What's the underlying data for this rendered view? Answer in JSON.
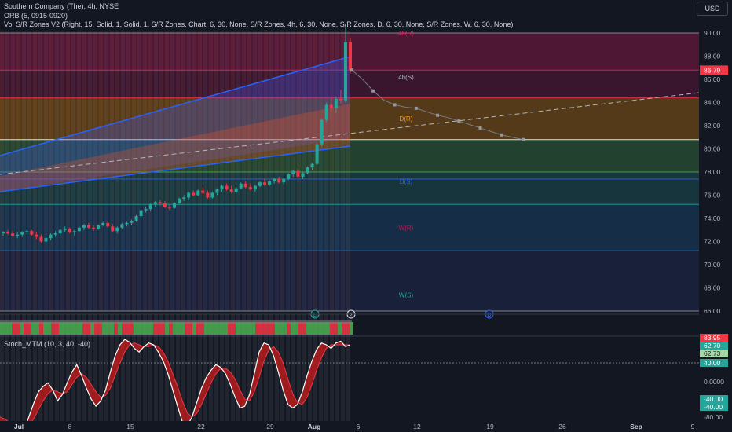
{
  "header": {
    "title": "Southern Company (The), 4h, NYSE",
    "orb": "ORB (5, 0915-0920)",
    "vol_sr": "Vol S/R Zones V2 (Right, 15, Solid, 1, Solid, 1, S/R Zones, Chart, 6, 30, None, S/R Zones, 4h, 6, 30, None, S/R Zones, D, 6, 30, None, S/R Zones, W, 6, 30, None)",
    "currency": "USD"
  },
  "chart_data": {
    "type": "candlestick",
    "price_axis": {
      "ticks": [
        "90.00",
        "88.00",
        "86.00",
        "84.00",
        "82.00",
        "80.00",
        "78.00",
        "76.00",
        "74.00",
        "72.00",
        "70.00",
        "68.00",
        "66.00"
      ],
      "ylim": [
        65.2,
        90.8
      ],
      "current_price": "86.79",
      "current_color": "#f23645"
    },
    "time_axis": {
      "labels": [
        "Jul",
        "8",
        "15",
        "22",
        "29",
        "Aug",
        "6",
        "12",
        "19",
        "26",
        "Sep",
        "9"
      ],
      "bold": [
        "Jul",
        "Aug",
        "Sep"
      ]
    },
    "zone_labels": [
      "4h(R)",
      "4h(S)",
      "D(R)",
      "D(S)",
      "W(R)",
      "W(S)"
    ],
    "event_markers": [
      "E",
      "⚡",
      "D"
    ],
    "candles": [
      [
        72.7,
        72.9,
        72.5,
        72.8
      ],
      [
        72.8,
        73.0,
        72.6,
        72.7
      ],
      [
        72.7,
        72.9,
        72.4,
        72.5
      ],
      [
        72.5,
        72.8,
        72.3,
        72.6
      ],
      [
        72.6,
        72.9,
        72.4,
        72.8
      ],
      [
        72.8,
        73.1,
        72.6,
        72.9
      ],
      [
        72.9,
        73.0,
        72.5,
        72.6
      ],
      [
        72.6,
        72.8,
        72.2,
        72.4
      ],
      [
        72.4,
        72.6,
        71.9,
        72.0
      ],
      [
        72.0,
        72.5,
        71.8,
        72.3
      ],
      [
        72.3,
        72.7,
        72.1,
        72.6
      ],
      [
        72.6,
        72.9,
        72.4,
        72.7
      ],
      [
        72.7,
        73.1,
        72.5,
        73.0
      ],
      [
        73.0,
        73.3,
        72.8,
        73.1
      ],
      [
        73.1,
        73.2,
        72.7,
        72.8
      ],
      [
        72.8,
        73.0,
        72.5,
        72.9
      ],
      [
        72.9,
        73.3,
        72.8,
        73.2
      ],
      [
        73.2,
        73.5,
        73.0,
        73.4
      ],
      [
        73.4,
        73.6,
        73.1,
        73.2
      ],
      [
        73.2,
        73.4,
        72.9,
        73.1
      ],
      [
        73.1,
        73.5,
        73.0,
        73.4
      ],
      [
        73.4,
        73.7,
        73.3,
        73.6
      ],
      [
        73.6,
        73.8,
        73.2,
        73.3
      ],
      [
        73.3,
        73.5,
        72.8,
        72.9
      ],
      [
        72.9,
        73.3,
        72.7,
        73.2
      ],
      [
        73.2,
        73.6,
        73.1,
        73.5
      ],
      [
        73.5,
        73.7,
        73.3,
        73.6
      ],
      [
        73.6,
        73.9,
        73.4,
        73.8
      ],
      [
        73.8,
        74.3,
        73.7,
        74.2
      ],
      [
        74.2,
        74.8,
        74.1,
        74.7
      ],
      [
        74.7,
        75.0,
        74.5,
        74.8
      ],
      [
        74.8,
        75.3,
        74.6,
        75.2
      ],
      [
        75.2,
        75.5,
        75.0,
        75.4
      ],
      [
        75.4,
        75.6,
        75.1,
        75.3
      ],
      [
        75.3,
        75.5,
        74.9,
        75.0
      ],
      [
        75.0,
        75.2,
        74.7,
        74.9
      ],
      [
        74.9,
        75.4,
        74.8,
        75.3
      ],
      [
        75.3,
        75.8,
        75.2,
        75.7
      ],
      [
        75.7,
        76.0,
        75.5,
        75.8
      ],
      [
        75.8,
        76.3,
        75.6,
        76.2
      ],
      [
        76.2,
        76.4,
        75.9,
        76.0
      ],
      [
        76.0,
        76.5,
        75.9,
        76.4
      ],
      [
        76.4,
        76.7,
        76.1,
        76.2
      ],
      [
        76.2,
        76.4,
        75.7,
        75.8
      ],
      [
        75.8,
        76.3,
        75.7,
        76.2
      ],
      [
        76.2,
        76.6,
        76.0,
        76.5
      ],
      [
        76.5,
        76.9,
        76.3,
        76.8
      ],
      [
        76.8,
        77.0,
        76.4,
        76.5
      ],
      [
        76.5,
        76.8,
        76.2,
        76.3
      ],
      [
        76.3,
        76.7,
        76.1,
        76.6
      ],
      [
        76.6,
        77.1,
        76.5,
        77.0
      ],
      [
        77.0,
        77.2,
        76.6,
        76.7
      ],
      [
        76.7,
        77.0,
        76.4,
        76.5
      ],
      [
        76.5,
        76.9,
        76.3,
        76.8
      ],
      [
        76.8,
        77.2,
        76.7,
        77.1
      ],
      [
        77.1,
        77.4,
        76.8,
        76.9
      ],
      [
        76.9,
        77.3,
        76.8,
        77.2
      ],
      [
        77.2,
        77.5,
        77.0,
        77.4
      ],
      [
        77.4,
        77.6,
        77.0,
        77.1
      ],
      [
        77.1,
        77.5,
        76.9,
        77.4
      ],
      [
        77.4,
        77.9,
        77.3,
        77.8
      ],
      [
        77.8,
        78.2,
        77.6,
        78.1
      ],
      [
        78.1,
        78.3,
        77.5,
        77.6
      ],
      [
        77.6,
        78.0,
        77.4,
        77.9
      ],
      [
        77.9,
        78.5,
        77.8,
        78.4
      ],
      [
        78.4,
        78.8,
        78.2,
        78.7
      ],
      [
        78.7,
        80.5,
        78.6,
        80.4
      ],
      [
        80.4,
        82.6,
        80.2,
        82.5
      ],
      [
        82.5,
        84.0,
        82.3,
        83.8
      ],
      [
        83.8,
        84.4,
        83.2,
        83.5
      ],
      [
        83.5,
        84.5,
        83.1,
        84.3
      ],
      [
        84.3,
        85.1,
        83.9,
        84.2
      ],
      [
        84.2,
        90.5,
        84.0,
        89.2
      ],
      [
        89.2,
        89.6,
        86.5,
        86.8
      ]
    ],
    "projection": [
      86.8,
      86.0,
      85.0,
      84.2,
      83.8,
      83.6,
      83.5,
      83.2,
      82.9,
      82.7,
      82.4,
      82.1,
      81.8,
      81.5,
      81.2,
      81.0,
      80.8
    ],
    "stoch_mtm": {
      "title": "Stoch_MTM (10, 3, 40, -40)",
      "ticks": [
        "0.0000",
        "-40.00",
        "-80.00"
      ],
      "ylim": [
        -82,
        88
      ],
      "badges": [
        "83.95",
        "62.70",
        "62.73",
        "40.00",
        "-40.00",
        "-40.00"
      ],
      "values": [
        -25,
        -28,
        -33,
        -38,
        -42,
        -34,
        -20,
        -5,
        8,
        14,
        18,
        10,
        -2,
        5,
        18,
        30,
        38,
        26,
        12,
        0,
        -8,
        -2,
        10,
        30,
        48,
        60,
        66,
        63,
        56,
        52,
        58,
        62,
        60,
        52,
        42,
        28,
        10,
        -8,
        -25,
        -30,
        -20,
        -4,
        12,
        24,
        32,
        38,
        35,
        28,
        16,
        2,
        -10,
        -8,
        5,
        28,
        52,
        62,
        60,
        48,
        30,
        10,
        -6,
        -10,
        -6,
        8,
        26,
        42,
        55,
        62,
        60,
        56,
        62,
        64,
        58,
        60
      ],
      "signal": [
        -20,
        -22,
        -26,
        -30,
        -34,
        -35,
        -30,
        -22,
        -12,
        -2,
        6,
        10,
        8,
        6,
        8,
        16,
        24,
        28,
        24,
        16,
        8,
        2,
        4,
        12,
        26,
        40,
        52,
        60,
        62,
        60,
        58,
        58,
        60,
        58,
        52,
        42,
        28,
        14,
        -2,
        -15,
        -20,
        -16,
        -6,
        6,
        18,
        28,
        34,
        34,
        30,
        22,
        10,
        0,
        -2,
        8,
        24,
        42,
        54,
        58,
        52,
        40,
        22,
        6,
        -4,
        -6,
        2,
        16,
        32,
        46,
        56,
        60,
        60,
        60,
        60,
        60
      ]
    }
  }
}
